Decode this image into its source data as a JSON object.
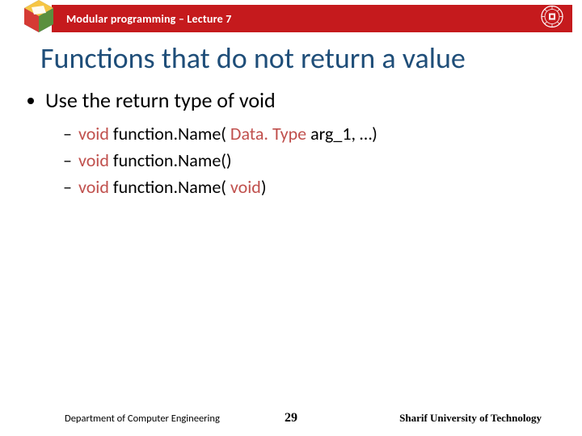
{
  "header": {
    "course": "Modular programming – Lecture 7"
  },
  "title": "Functions that do not return a value",
  "bullets": {
    "main": "Use the return type of void",
    "sub": [
      {
        "kw1": "void",
        "mid": " function.Name( ",
        "kw2": "Data. Type",
        "tail": " arg_1, …)"
      },
      {
        "kw1": "void",
        "mid": " function.Name()",
        "kw2": "",
        "tail": ""
      },
      {
        "kw1": "void",
        "mid": " function.Name( ",
        "kw2": "void",
        "tail": ")"
      }
    ]
  },
  "footer": {
    "department": "Department of Computer Engineering",
    "page": "29",
    "university": "Sharif University of Technology"
  }
}
